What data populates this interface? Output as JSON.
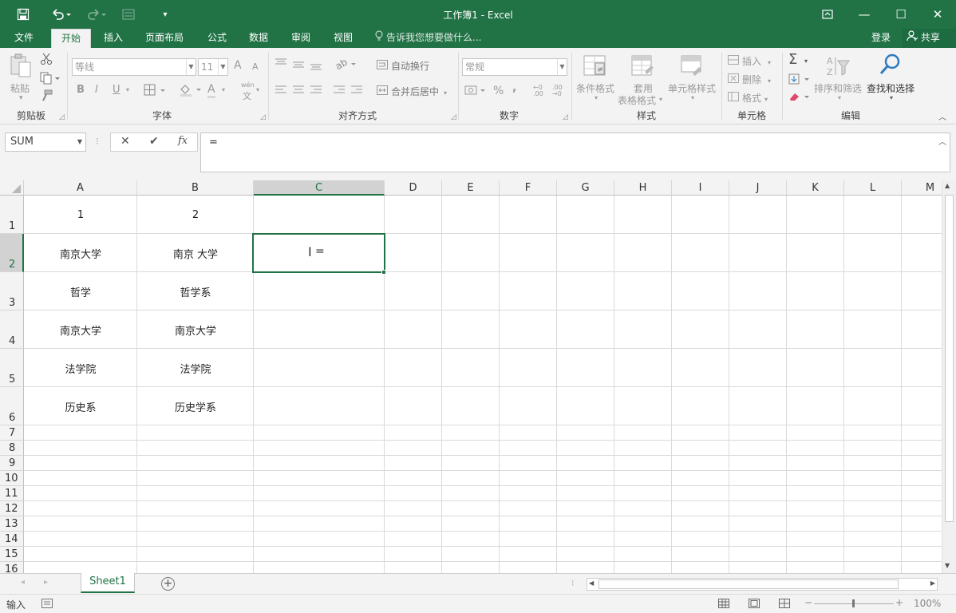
{
  "window": {
    "title": "工作簿1 - Excel",
    "save_icon": "save-icon",
    "undo_icon": "undo-icon",
    "redo_icon": "redo-icon",
    "ribbon_display_icon": "ribbon-display-options-icon",
    "minimize_glyph": "—",
    "maximize_glyph": "☐",
    "close_glyph": "✕"
  },
  "tabs": {
    "file": "文件",
    "home": "开始",
    "insert": "插入",
    "page_layout": "页面布局",
    "formulas": "公式",
    "data": "数据",
    "review": "审阅",
    "view": "视图",
    "tell_me": "告诉我您想要做什么...",
    "login": "登录",
    "share": "共享"
  },
  "ribbon": {
    "clipboard": {
      "paste": "粘贴",
      "label": "剪贴板"
    },
    "font": {
      "font_name": "等线",
      "font_size": "11",
      "bold": "B",
      "italic": "I",
      "underline": "U",
      "phonetic_top": "wén",
      "phonetic_bottom": "文",
      "font_color": "A",
      "grow": "A",
      "shrink": "A",
      "label": "字体"
    },
    "alignment": {
      "wrap_text": "自动换行",
      "merge_center": "合并后居中",
      "label": "对齐方式"
    },
    "number": {
      "format": "常规",
      "percent": "%",
      "comma": ",",
      "inc_decimal": "←0 .00",
      "dec_decimal": ".00 →0",
      "label": "数字"
    },
    "styles": {
      "conditional": "条件格式",
      "table_top": "套用",
      "table_bottom": "表格格式",
      "cell_styles": "单元格样式",
      "label": "样式"
    },
    "cells": {
      "insert": "插入",
      "delete": "删除",
      "format": "格式",
      "label": "单元格"
    },
    "editing": {
      "sum_glyph": "Σ",
      "sort_filter": "排序和筛选",
      "find_select": "查找和选择",
      "label": "编辑"
    }
  },
  "formula_bar": {
    "name_box": "SUM",
    "cancel": "✕",
    "enter": "✔",
    "fx": "fx",
    "content": "="
  },
  "grid": {
    "columns": [
      "A",
      "B",
      "C",
      "D",
      "E",
      "F",
      "G",
      "H",
      "I",
      "J",
      "K",
      "L",
      "M"
    ],
    "selected_column": "C",
    "rows": [
      "1",
      "2",
      "3",
      "4",
      "5",
      "6",
      "7",
      "8",
      "9",
      "10",
      "11",
      "12",
      "13",
      "14",
      "15",
      "16"
    ],
    "selected_row": "2",
    "cells": {
      "A1": "1",
      "B1": "2",
      "A2": "南京大学",
      "B2": "南京 大学",
      "A3": "哲学",
      "B3": "哲学系",
      "A4": "南京大学",
      "B4": "南京大学",
      "A5": "法学院",
      "B5": "法学院",
      "A6": "历史系",
      "B6": "历史学系"
    },
    "active_cell": "C2",
    "active_cell_text": "="
  },
  "sheets": {
    "tabs": [
      "Sheet1"
    ],
    "add_glyph": "+"
  },
  "status": {
    "mode": "输入",
    "zoom": "100%"
  },
  "colors": {
    "accent": "#217346",
    "ribbon_bg": "#f3f3f3"
  }
}
